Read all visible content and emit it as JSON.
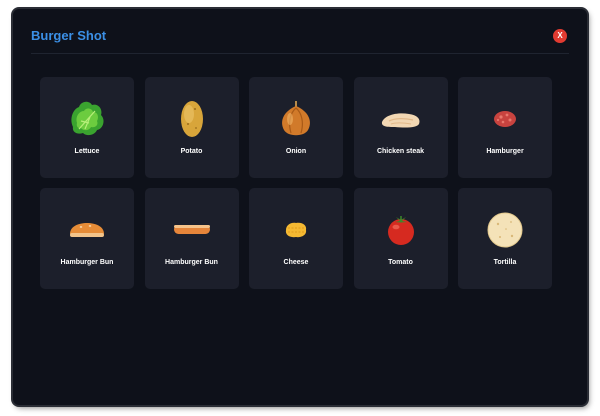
{
  "app": {
    "title": "Burger Shot",
    "close_label": "X"
  },
  "items": [
    {
      "label": "Lettuce",
      "icon": "lettuce-icon"
    },
    {
      "label": "Potato",
      "icon": "potato-icon"
    },
    {
      "label": "Onion",
      "icon": "onion-icon"
    },
    {
      "label": "Chicken steak",
      "icon": "chicken-steak-icon"
    },
    {
      "label": "Hamburger",
      "icon": "hamburger-patty-icon"
    },
    {
      "label": "Hamburger Bun",
      "icon": "bun-top-icon"
    },
    {
      "label": "Hamburger Bun",
      "icon": "bun-bottom-icon"
    },
    {
      "label": "Cheese",
      "icon": "cheese-icon"
    },
    {
      "label": "Tomato",
      "icon": "tomato-icon"
    },
    {
      "label": "Tortilla",
      "icon": "tortilla-icon"
    }
  ],
  "colors": {
    "background": "#0e111a",
    "card": "#1c1f2b",
    "title": "#3b8fe5",
    "close": "#e23b31"
  }
}
